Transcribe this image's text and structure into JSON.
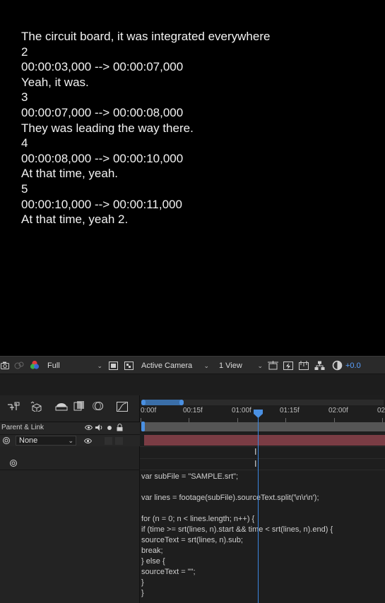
{
  "subtitles": [
    "The circuit board, it was integrated everywhere",
    "2",
    "00:00:03,000 --> 00:00:07,000",
    "Yeah, it was.",
    "3",
    "00:00:07,000 --> 00:00:08,000",
    "They was leading the way there.",
    "4",
    "00:00:08,000 --> 00:00:10,000",
    "At that time, yeah.",
    "5",
    "00:00:10,000 --> 00:00:11,000",
    "At that time, yeah 2."
  ],
  "viewer_toolbar": {
    "resolution": "Full",
    "camera": "Active Camera",
    "views": "1 View",
    "exposure": "+0.0"
  },
  "timeline": {
    "header_label": "Parent & Link",
    "parent_value": "None",
    "ruler_ticks": [
      "0:00f",
      "00:15f",
      "01:00f",
      "01:15f",
      "02:00f",
      "02"
    ],
    "code_lines": [
      "var subFile = \"SAMPLE.srt\";",
      "",
      "var lines = footage(subFile).sourceText.split('\\n\\r\\n');",
      "",
      "for (n = 0; n < lines.length; n++) {",
      "if (time >= srt(lines, n).start && time < srt(lines, n).end) {",
      "sourceText = srt(lines, n).sub;",
      "break;",
      "} else {",
      "sourceText = \"\";",
      "}",
      "}"
    ]
  },
  "colors": {
    "accent": "#4a90e2",
    "layer_bar": "#7a3c44",
    "exposure_text": "#5aa0ff"
  }
}
